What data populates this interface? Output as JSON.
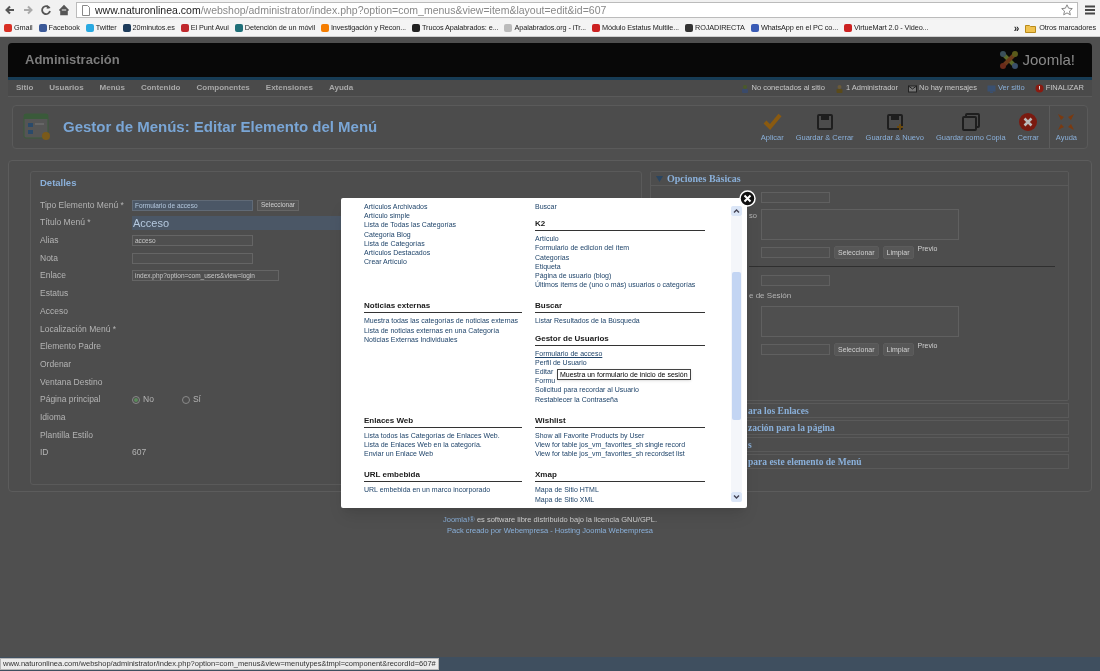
{
  "browser": {
    "url_host": "www.naturonlinea.com",
    "url_path": "/webshop/administrator/index.php?option=com_menus&view=item&layout=edit&id=607",
    "bookmarks": [
      {
        "label": "Gmail",
        "color": "#d93025"
      },
      {
        "label": "Facebook",
        "color": "#3b5998"
      },
      {
        "label": "Twitter",
        "color": "#29a9e1"
      },
      {
        "label": "20minutos.es",
        "color": "#1d3b5a"
      },
      {
        "label": "El Punt Avui",
        "color": "#c0282d"
      },
      {
        "label": "Detención de un móvil",
        "color": "#1f6f78"
      },
      {
        "label": "Investigación y Recon...",
        "color": "#f57d00"
      },
      {
        "label": "Trucos Apalabrados: e...",
        "color": "#222222"
      },
      {
        "label": "Apalabrados.org - iTr...",
        "color": "#bbbbbb"
      },
      {
        "label": "Módulo Estatus Multile...",
        "color": "#cc2222"
      },
      {
        "label": "ROJADIRECTA",
        "color": "#333333"
      },
      {
        "label": "WhatsApp en el PC co...",
        "color": "#3a5bb5"
      },
      {
        "label": "VirtueMart 2.0 - Video...",
        "color": "#cc2222"
      }
    ],
    "overflow": "»",
    "other_bookmarks": "Otros marcadores"
  },
  "header": {
    "title": "Administración",
    "logo": "Joomla!"
  },
  "menu": [
    "Sitio",
    "Usuarios",
    "Menús",
    "Contenido",
    "Componentes",
    "Extensiones",
    "Ayuda"
  ],
  "status": [
    {
      "kind": "users",
      "text": "No conectados al sitio"
    },
    {
      "kind": "admin",
      "text": "1 Administrador"
    },
    {
      "kind": "messages",
      "text": "No hay mensajes"
    },
    {
      "kind": "site",
      "text": "Ver sitio"
    },
    {
      "kind": "logout",
      "text": "FINALIZAR"
    }
  ],
  "toolbar": {
    "title": "Gestor de Menús: Editar Elemento del Menú",
    "buttons": [
      {
        "kind": "apply",
        "label": "Aplicar"
      },
      {
        "kind": "save",
        "label": "Guardar & Cerrar"
      },
      {
        "kind": "save-new",
        "label": "Guardar & Nuevo"
      },
      {
        "kind": "save-copy",
        "label": "Guardar como Copia"
      },
      {
        "kind": "cancel",
        "label": "Cerrar"
      },
      {
        "kind": "help",
        "label": "Ayuda"
      }
    ]
  },
  "details": {
    "legend": "Detalles",
    "required_mark": "*",
    "fields": [
      {
        "label": "Tipo Elemento Menú",
        "required": true,
        "kind": "select",
        "value": "Formulario de acceso",
        "button": "Seleccionar"
      },
      {
        "label": "Título Menú",
        "required": true,
        "kind": "title",
        "value": "Acceso"
      },
      {
        "label": "Alias",
        "required": false,
        "kind": "text",
        "value": "acceso"
      },
      {
        "label": "Nota",
        "required": false,
        "kind": "text"
      },
      {
        "label": "Enlace",
        "required": false,
        "kind": "link",
        "value": "index.php?option=com_users&view=login"
      },
      {
        "label": "Estatus",
        "required": false,
        "kind": "empty"
      },
      {
        "label": "Acceso",
        "required": false,
        "kind": "empty"
      },
      {
        "label": "Localización Menú",
        "required": true,
        "kind": "empty"
      },
      {
        "label": "Elemento Padre",
        "required": false,
        "kind": "empty"
      },
      {
        "label": "Ordenar",
        "required": false,
        "kind": "empty"
      },
      {
        "label": "Ventana Destino",
        "required": false,
        "kind": "empty"
      },
      {
        "label": "Página principal",
        "required": false,
        "kind": "radio",
        "options": [
          {
            "label": "No",
            "selected": true
          },
          {
            "label": "Sí",
            "selected": false
          }
        ]
      },
      {
        "label": "Idioma",
        "required": false,
        "kind": "empty"
      },
      {
        "label": "Plantilla Estilo",
        "required": false,
        "kind": "empty"
      },
      {
        "label": "ID",
        "required": false,
        "kind": "static",
        "value": "607"
      }
    ]
  },
  "basic_options": {
    "title": "Opciones Básicas",
    "rows": [
      {
        "kind": "input"
      },
      {
        "kind": "textarea",
        "label": "so"
      },
      {
        "kind": "picker",
        "buttons": [
          "Seleccionar",
          "Limpiar"
        ],
        "preview": "Previo"
      },
      {
        "kind": "divider"
      },
      {
        "kind": "input"
      },
      {
        "kind": "label",
        "label": "e de Sesión"
      },
      {
        "kind": "textarea"
      },
      {
        "kind": "picker",
        "buttons": [
          "Seleccionar",
          "Limpiar"
        ],
        "preview": "Previo"
      }
    ]
  },
  "collapsed_sections": [
    "ara los Enlaces",
    "zación para la página",
    "s",
    "para este elemento de Menú"
  ],
  "modal": {
    "rows": [
      {
        "left": [
          {
            "items": [
              {
                "label": "Artículos Archivados",
                "hovered": false
              },
              {
                "label": "Artículo simple",
                "hovered": false
              },
              {
                "label": "Lista de Todas las Categorías",
                "hovered": false
              },
              {
                "label": "Categoría Blog",
                "hovered": false
              },
              {
                "label": "Lista de Categorías",
                "hovered": false
              },
              {
                "label": "Artículos Destacados",
                "hovered": false
              },
              {
                "label": "Crear Artículo",
                "hovered": false
              }
            ]
          }
        ],
        "right": [
          {
            "items": [
              {
                "label": "Buscar",
                "hovered": false
              }
            ]
          },
          {
            "heading": "K2",
            "items": [
              {
                "label": "Artículo",
                "hovered": false
              },
              {
                "label": "Formulario de edicion del ítem",
                "hovered": false
              },
              {
                "label": "Categorías",
                "hovered": false
              },
              {
                "label": "Etiqueta",
                "hovered": false
              },
              {
                "label": "Página de usuario (blog)",
                "hovered": false
              },
              {
                "label": "Últimos ítems de (uno o más) usuarios o categorías",
                "hovered": false
              }
            ]
          }
        ]
      },
      {
        "left": [
          {
            "heading": "Noticias externas",
            "items": [
              {
                "label": "Muestra todas las categorías de noticias externas",
                "hovered": false
              },
              {
                "label": "Lista de noticias externas en una Categoría",
                "hovered": false
              },
              {
                "label": "Noticias Externas Individuales",
                "hovered": false
              }
            ]
          }
        ],
        "right": [
          {
            "heading": "Buscar",
            "items": [
              {
                "label": "Listar Resultados de la Búsqueda",
                "hovered": false
              }
            ]
          },
          {
            "heading": "Gestor de Usuarios",
            "items": [
              {
                "label": "Formulario de acceso",
                "hovered": true
              },
              {
                "label": "Perfil de Usuario",
                "hovered": false
              },
              {
                "label": "Editar",
                "hovered": false
              },
              {
                "label": "Formu",
                "hovered": false
              },
              {
                "label": "Solicitud para recordar al Usuario",
                "hovered": false
              },
              {
                "label": "Restablecer la Contraseña",
                "hovered": false
              }
            ]
          }
        ]
      },
      {
        "left": [
          {
            "heading": "Enlaces Web",
            "items": [
              {
                "label": "Lista todos las Categorías de Enlaces Web.",
                "hovered": false
              },
              {
                "label": "Lista de Enlaces Web en la categoría.",
                "hovered": false
              },
              {
                "label": "Enviar un Enlace Web",
                "hovered": false
              }
            ]
          }
        ],
        "right": [
          {
            "heading": "Wishlist",
            "items": [
              {
                "label": "Show all Favorite Products by User",
                "hovered": false
              },
              {
                "label": "View for table jos_vm_favorites_sh single record",
                "hovered": false
              },
              {
                "label": "View for table jos_vm_favorites_sh recordset list",
                "hovered": false
              }
            ]
          }
        ]
      },
      {
        "left": [
          {
            "heading": "URL embebida",
            "items": [
              {
                "label": "URL embebida en un marco incorporado",
                "hovered": false
              }
            ]
          }
        ],
        "right": [
          {
            "heading": "Xmap",
            "items": [
              {
                "label": "Mapa de Sitio HTML",
                "hovered": false
              },
              {
                "label": "Mapa de Sitio XML",
                "hovered": false
              }
            ]
          }
        ]
      }
    ],
    "tooltip": "Muestra un formulario de inicio de sesión"
  },
  "footer": {
    "link": "Joomla!®",
    "text": "es software libre distribuido bajo la licencia GNU/GPL.",
    "credit": "Pack creado por Webempresa - Hosting Joomla Webempresa"
  },
  "status_bar": "www.naturonlinea.com/webshop/administrator/index.php?option=com_menus&view=menutypes&tmpl=component&recordId=607#"
}
